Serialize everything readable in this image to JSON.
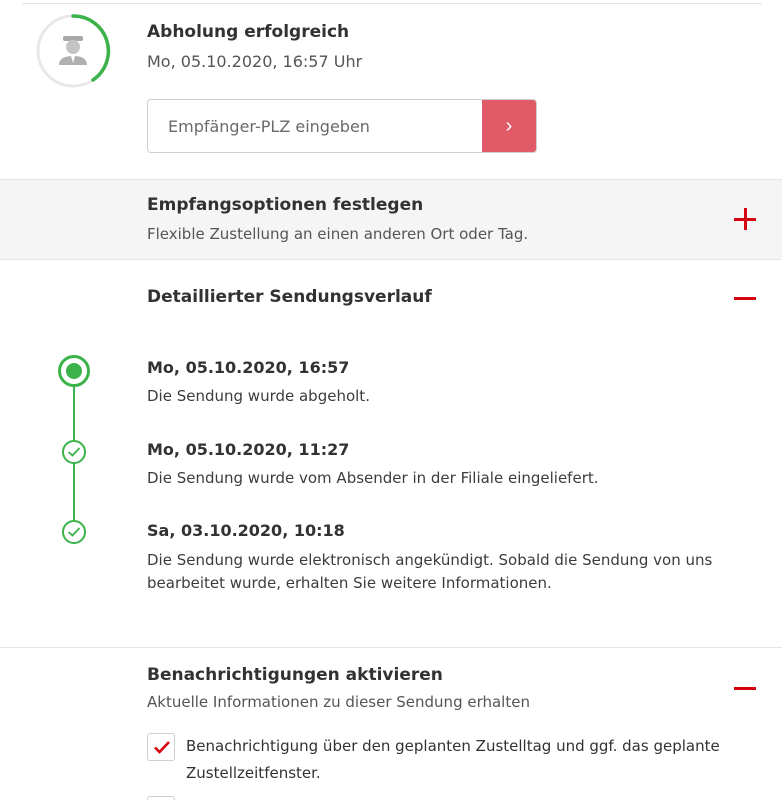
{
  "status": {
    "title": "Abholung erfolgreich",
    "date": "Mo, 05.10.2020, 16:57 Uhr",
    "icon": "courier-avatar-icon",
    "progress_color": "#3bb34a"
  },
  "plz": {
    "placeholder": "Empfänger-PLZ eingeben",
    "button_glyph": "›"
  },
  "empfangsoptionen": {
    "title": "Empfangsoptionen festlegen",
    "subtitle": "Flexible Zustellung an einen anderen Ort oder Tag.",
    "toggle_icon": "plus-icon"
  },
  "verlauf": {
    "title": "Detaillierter Sendungsverlauf",
    "toggle_icon": "minus-icon",
    "events": [
      {
        "date": "Mo, 05.10.2020, 16:57",
        "text": "Die Sendung wurde abgeholt.",
        "state": "active"
      },
      {
        "date": "Mo, 05.10.2020, 11:27",
        "text": "Die Sendung wurde vom Absender in der Filiale eingeliefert.",
        "state": "done"
      },
      {
        "date": "Sa, 03.10.2020, 10:18",
        "text": "Die Sendung wurde elektronisch angekündigt. Sobald die Sendung von uns bearbeitet wurde, erhalten Sie weitere Informationen.",
        "state": "done"
      }
    ]
  },
  "benachrichtigungen": {
    "title": "Benachrichtigungen aktivieren",
    "subtitle": "Aktuelle Informationen zu dieser Sendung erhalten",
    "toggle_icon": "minus-icon",
    "options": [
      {
        "label": "Benachrichtigung über den geplanten Zustelltag und ggf. das geplante Zustellzeitfenster.",
        "checked": true
      },
      {
        "label": "",
        "checked": false
      }
    ]
  },
  "colors": {
    "accent_red": "#d40511",
    "button_red": "#e05a67",
    "timeline_green": "#3bb34a"
  }
}
